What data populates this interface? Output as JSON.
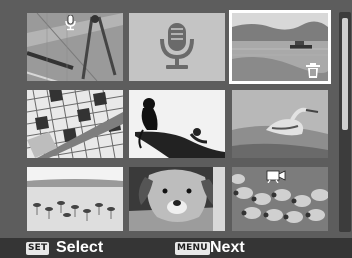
{
  "footer": {
    "set_badge": "SET",
    "select_label": "Select",
    "menu_badge": "MENU",
    "next_label": "Next"
  },
  "thumbnails": [
    {
      "subject": "drafting tools",
      "has_voice_memo": true
    },
    {
      "subject": "voice memo only",
      "has_voice_memo": true
    },
    {
      "subject": "lake with boat",
      "has_trash": true,
      "selected": true
    },
    {
      "subject": "crossword and pencil"
    },
    {
      "subject": "silhouette monkey on branch"
    },
    {
      "subject": "heron on shore"
    },
    {
      "subject": "flamingos in water"
    },
    {
      "subject": "dog face"
    },
    {
      "subject": "sheep flock",
      "has_movie": true
    }
  ],
  "colors": {
    "background": "#5d5d5d",
    "footer": "#353535",
    "selection": "#ffffff"
  }
}
